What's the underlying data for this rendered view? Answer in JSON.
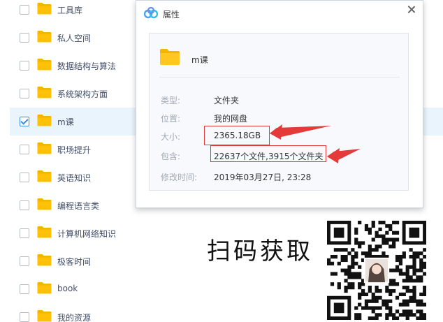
{
  "file_list": {
    "rows": [
      {
        "name": "工具库",
        "checked": false
      },
      {
        "name": "私人空间",
        "checked": false
      },
      {
        "name": "数据结构与算法",
        "checked": false
      },
      {
        "name": "系统架构方面",
        "checked": false
      },
      {
        "name": "m课",
        "checked": true
      },
      {
        "name": "职场提升",
        "checked": false
      },
      {
        "name": "英语知识",
        "checked": false
      },
      {
        "name": "编程语言类",
        "checked": false
      },
      {
        "name": "计算机网络知识",
        "checked": false
      },
      {
        "name": "极客时间",
        "checked": false
      },
      {
        "name": "book",
        "checked": false
      },
      {
        "name": "我的资源",
        "checked": false
      }
    ],
    "partial_date": "2019-03-27 23:28"
  },
  "dialog": {
    "title": "属性",
    "folder_name": "m课",
    "props": [
      {
        "label": "类型:",
        "value": "文件夹",
        "highlight": false
      },
      {
        "label": "位置:",
        "value": "我的网盘",
        "highlight": false
      },
      {
        "label": "大小:",
        "value": "2365.18GB",
        "highlight": true
      },
      {
        "label": "包含:",
        "value": "22637个文件,3915个文件夹",
        "highlight": true
      },
      {
        "label": "修改时间:",
        "value": "2019年03月27日, 23:28",
        "highlight": false
      }
    ]
  },
  "promo": {
    "text": "扫码获取",
    "qr_icon": "qr-code-with-avatar"
  },
  "colors": {
    "folder": "#ffc107",
    "folder_tab": "#f5b400",
    "annotation_red": "#e53a3a",
    "selected_row": "#eaf4fd",
    "checkbox_checked": "#3b8ee8"
  }
}
